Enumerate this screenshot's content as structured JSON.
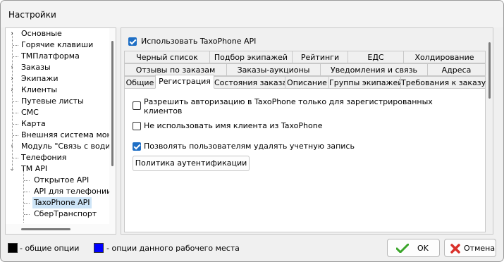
{
  "window": {
    "title": "Настройки"
  },
  "tree": {
    "items": [
      {
        "label": "Основные"
      },
      {
        "label": "Горячие клавиши"
      },
      {
        "label": "ТМПлатформа"
      },
      {
        "label": "Заказы"
      },
      {
        "label": "Экипажи"
      },
      {
        "label": "Клиенты"
      },
      {
        "label": "Путевые листы"
      },
      {
        "label": "СМС"
      },
      {
        "label": "Карта"
      },
      {
        "label": "Внешняя система мони"
      },
      {
        "label": "Модуль \"Связь с водит"
      },
      {
        "label": "Телефония"
      },
      {
        "label": "TM API"
      },
      {
        "label": "Открытое API"
      },
      {
        "label": "API для телефонии"
      },
      {
        "label": "TaxoPhone API"
      },
      {
        "label": "СберТранспорт"
      }
    ],
    "selected": "TaxoPhone API"
  },
  "panel": {
    "use_api": {
      "label": "Использовать TaxoPhone API",
      "checked": true
    },
    "tabs_row1": [
      "Черный список",
      "Подбор экипажей",
      "Рейтинги",
      "ЕДС",
      "Холдирование"
    ],
    "tabs_row2": [
      "Отзывы по заказам",
      "Заказы-аукционы",
      "Уведомления и связь",
      "Адреса"
    ],
    "tabs_row3": [
      "Общие",
      "Регистрация",
      "Состояния заказа",
      "Описание",
      "Группы экипажей",
      "Требования к заказу"
    ],
    "active_tab": "Регистрация",
    "options": [
      {
        "label": "Разрешить авторизацию в TaxoPhone только для зарегистрированных",
        "label2": "клиентов",
        "checked": false
      },
      {
        "label": "Не использовать имя клиента из TaxoPhone",
        "checked": false
      },
      {
        "label": "Позволять пользователям удалять учетную запись",
        "checked": true
      }
    ],
    "auth_policy_button": "Политика аутентификации"
  },
  "footer": {
    "legend_common": "- общие опции",
    "legend_workplace": "- опции данного рабочего места",
    "ok": "OK",
    "cancel": "Отмена"
  },
  "colors": {
    "accent": "#1f6fc5",
    "legend_common": "#000000",
    "legend_workplace": "#0000ff"
  }
}
